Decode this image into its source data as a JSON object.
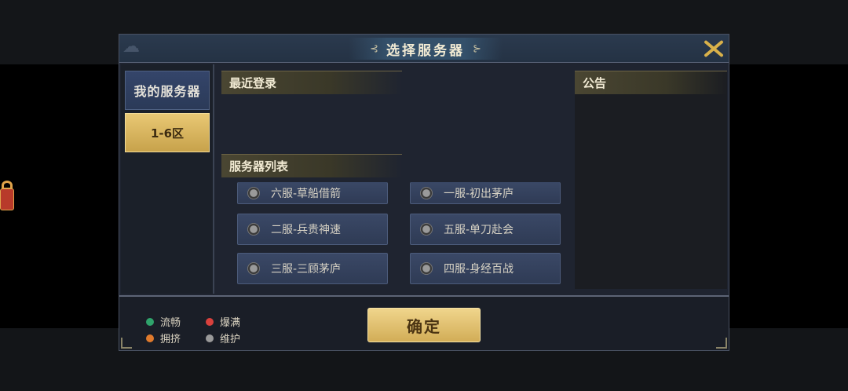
{
  "dialog": {
    "title": "选择服务器",
    "left_ornament": "⊰",
    "right_ornament": "⊱"
  },
  "tabs": {
    "my_servers": "我的服务器",
    "zone": "1-6区"
  },
  "sections": {
    "recent": "最近登录",
    "server_list": "服务器列表",
    "notice": "公告"
  },
  "servers": [
    {
      "label": "六服-草船借箭",
      "status": "维护"
    },
    {
      "label": "一服-初出茅庐",
      "status": "维护"
    },
    {
      "label": "二服-兵贵神速",
      "status": "维护"
    },
    {
      "label": "五服-单刀赴会",
      "status": "维护"
    },
    {
      "label": "三服-三顾茅庐",
      "status": "维护"
    },
    {
      "label": "四服-身经百战",
      "status": "维护"
    }
  ],
  "legend": [
    {
      "label": "流畅",
      "color": "#2fa36b"
    },
    {
      "label": "爆满",
      "color": "#d9413d"
    },
    {
      "label": "拥挤",
      "color": "#e07a2c"
    },
    {
      "label": "维护",
      "color": "#9a9a9a"
    }
  ],
  "confirm_label": "确定",
  "colors": {
    "accent_gold": "#d2ad57",
    "panel_bg": "#1f2430"
  }
}
